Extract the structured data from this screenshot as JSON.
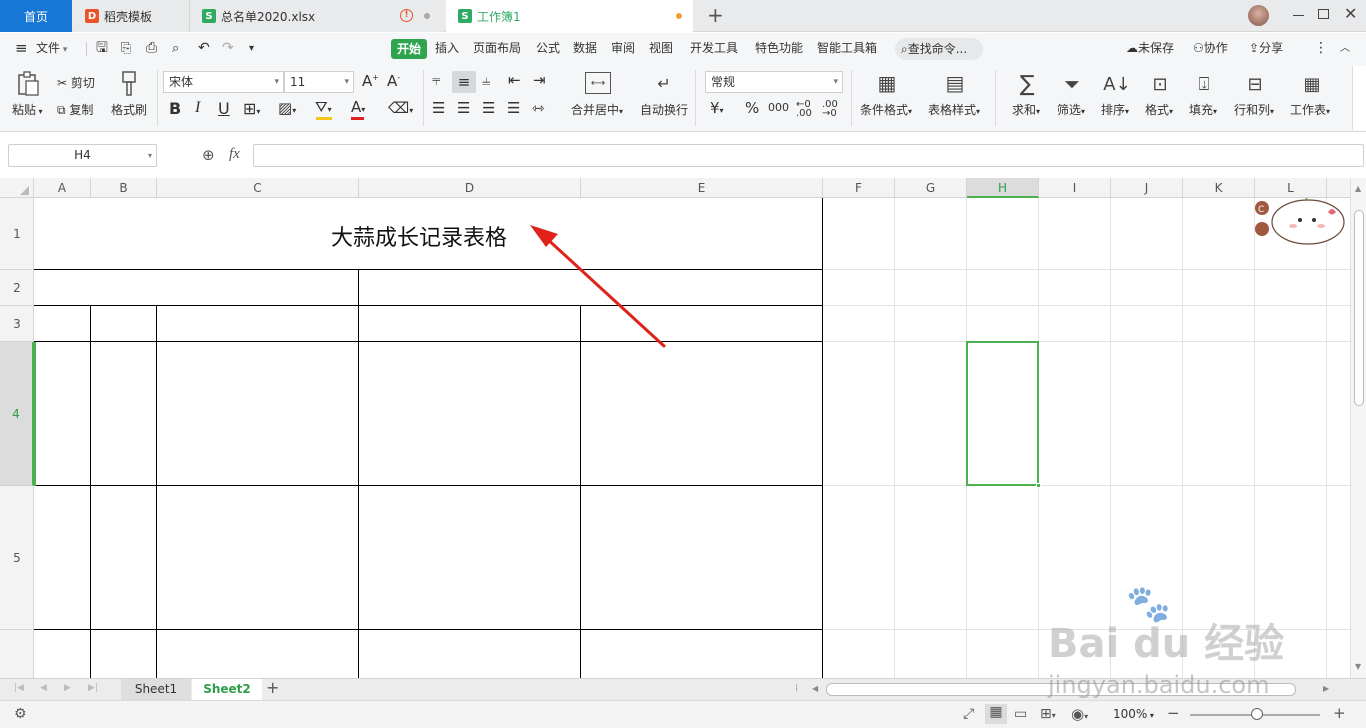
{
  "tabs": {
    "home": "首页",
    "docer": "稻壳模板",
    "file1": "总名单2020.xlsx",
    "file2": "工作簿1",
    "new_tab": "+"
  },
  "menu": {
    "file": "文件",
    "items": [
      "开始",
      "插入",
      "页面布局",
      "公式",
      "数据",
      "审阅",
      "视图",
      "开发工具",
      "特色功能",
      "智能工具箱"
    ],
    "search": "查找命令...",
    "unsaved": "未保存",
    "collab": "协作",
    "share": "分享"
  },
  "ribbon": {
    "paste": "粘贴",
    "cut": "剪切",
    "copy": "复制",
    "format_painter": "格式刷",
    "font_name": "宋体",
    "font_size": "11",
    "bold": "B",
    "italic": "I",
    "underline": "U",
    "merge_center": "合并居中",
    "wrap_text": "自动换行",
    "number_format": "常规",
    "currency": "¥",
    "percent": "%",
    "thousands": "000",
    "conditional_format": "条件格式",
    "table_style": "表格样式",
    "sum": "求和",
    "filter": "筛选",
    "sort": "排序",
    "format": "格式",
    "fill": "填充",
    "row_col": "行和列",
    "worksheet": "工作表"
  },
  "formula": {
    "cell_ref": "H4",
    "fx": "fx",
    "value": ""
  },
  "grid": {
    "columns": [
      "A",
      "B",
      "C",
      "D",
      "E",
      "F",
      "G",
      "H",
      "I",
      "J",
      "K",
      "L"
    ],
    "rows": [
      "1",
      "2",
      "3",
      "4",
      "5"
    ],
    "selected_col": "H",
    "selected_row": "4",
    "title_cell": "大蒜成长记录表格"
  },
  "sheets": [
    "Sheet1",
    "Sheet2"
  ],
  "active_sheet": "Sheet2",
  "status": {
    "zoom": "100%"
  },
  "watermark": {
    "brand": "Bai du 经验",
    "url": "jingyan.baidu.com"
  },
  "colors": {
    "accent_green": "#4caf50",
    "tab_blue": "#1677d4",
    "arrow_red": "#e0221b"
  }
}
